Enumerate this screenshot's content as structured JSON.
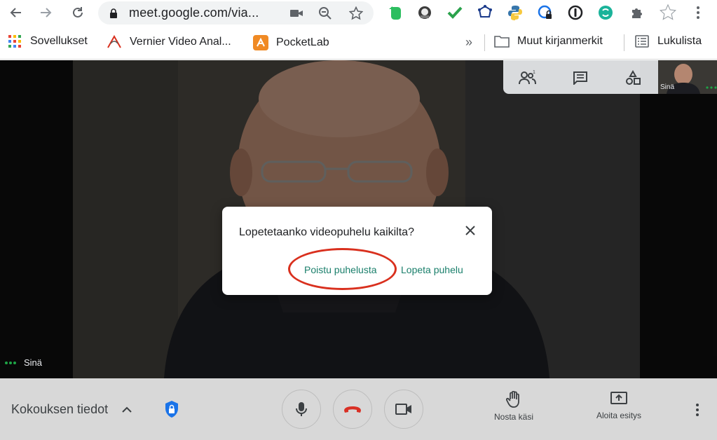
{
  "browser": {
    "url": "meet.google.com/via...",
    "bookmarks": [
      {
        "label": "Sovellukset",
        "icon": "apps-grid-icon"
      },
      {
        "label": "Vernier Video Anal...",
        "icon": "vernier-icon"
      },
      {
        "label": "PocketLab",
        "icon": "pocketlab-icon"
      }
    ],
    "overflow_label": "»",
    "other_bookmarks": "Muut kirjanmerkit",
    "reading_list": "Lukulista"
  },
  "meet": {
    "participant_name": "Sinä",
    "selfview_name": "Sinä",
    "meeting_details": "Kokouksen tiedot",
    "raise_hand": "Nosta käsi",
    "present_now": "Aloita esitys"
  },
  "dialog": {
    "title": "Lopetetaanko videopuhelu kaikilta?",
    "leave_label": "Poistu puhelusta",
    "end_label": "Lopeta puhelu"
  },
  "colors": {
    "accent": "#1a7f6b",
    "highlight": "#d9301e",
    "hangup": "#d93025"
  }
}
